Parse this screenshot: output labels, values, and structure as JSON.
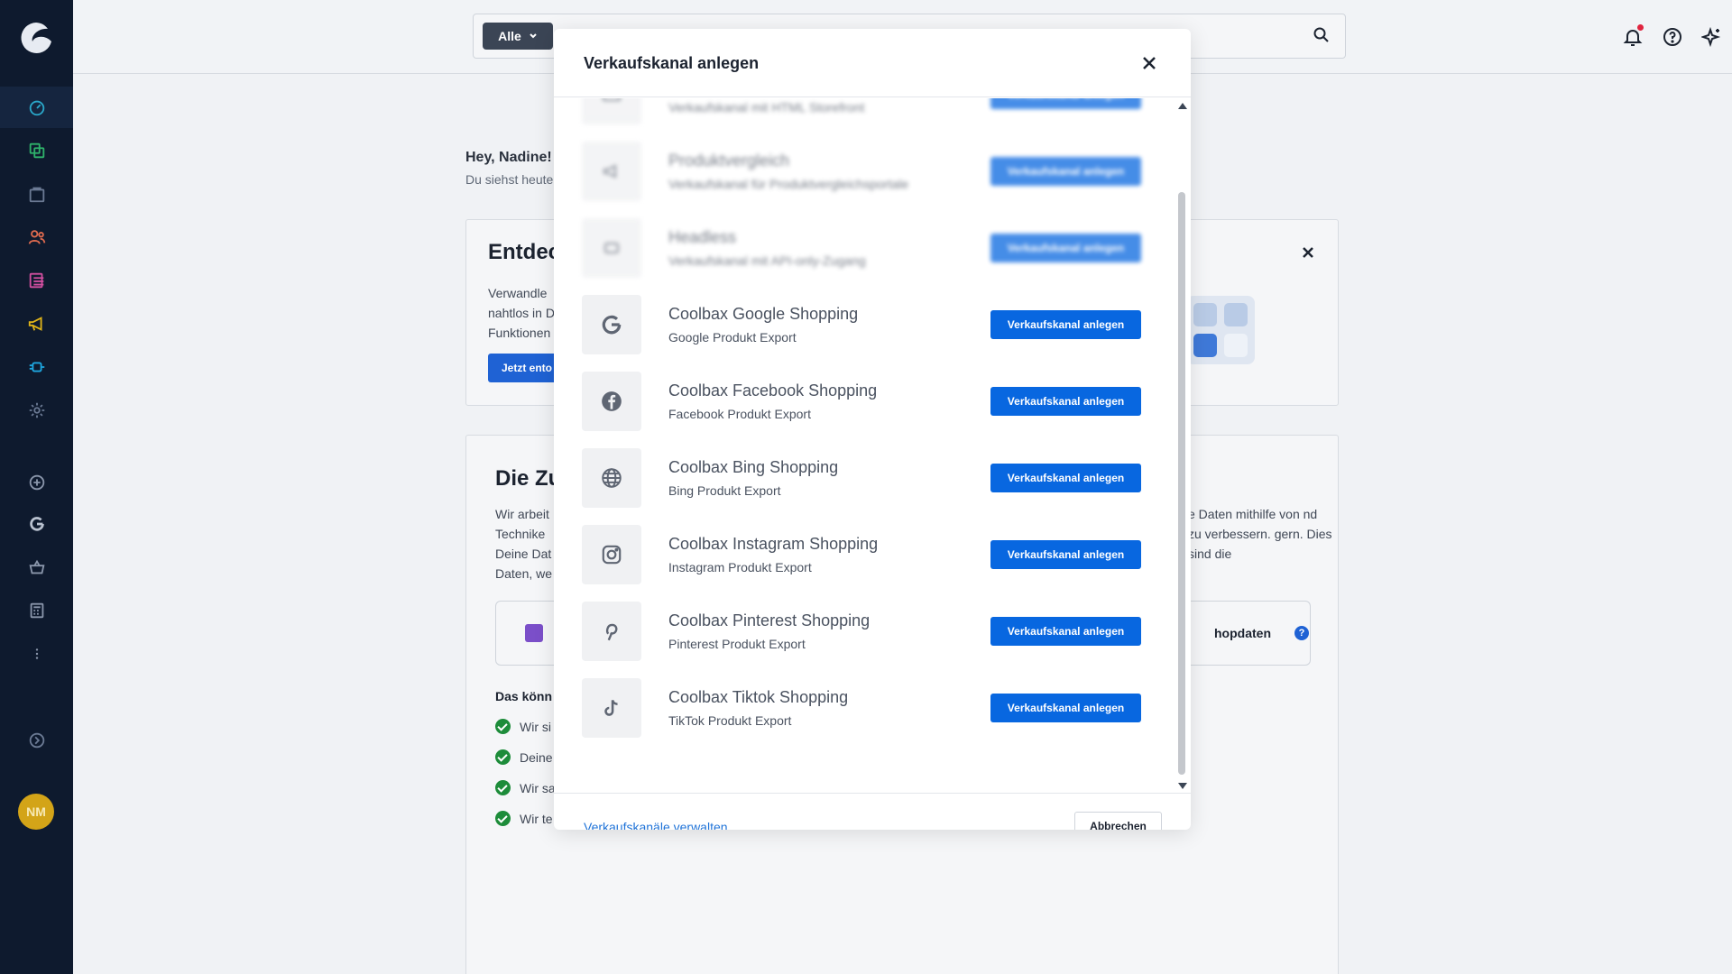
{
  "topbar": {
    "search_scope": "Alle"
  },
  "avatar": {
    "initials": "NM"
  },
  "dashboard": {
    "greeting": "Hey, Nadine!",
    "greeting_sub": "Du siehst heute",
    "card1": {
      "title": "Entdec",
      "text": "Verwandle nahtlos in D Funktionen",
      "button": "Jetzt ento"
    },
    "card2": {
      "title": "Die Zu",
      "text_left": "Wir arbeit Technike Deine Dat Daten, we",
      "text_right": "e Daten mithilfe von nd zu verbessern. gern. Dies sind die",
      "box_label": "hopdaten",
      "help": "?",
      "sub_heading": "Das könn",
      "checks": [
        "Wir si",
        "Deine",
        "Wir sa",
        "Wir te"
      ]
    }
  },
  "modal": {
    "title": "Verkaufskanal anlegen",
    "channels": [
      {
        "name": "",
        "desc": "Verkaufskanal mit HTML Storefront",
        "button": "Verkaufskanal anlegen",
        "icon": "storefront-icon",
        "blurred": true
      },
      {
        "name": "Produktvergleich",
        "desc": "Verkaufskanal für Produktvergleichsportale",
        "button": "Verkaufskanal anlegen",
        "icon": "megaphone-icon",
        "blurred": true
      },
      {
        "name": "Headless",
        "desc": "Verkaufskanal mit API-only-Zugang",
        "button": "Verkaufskanal anlegen",
        "icon": "plugin-icon",
        "blurred": true
      },
      {
        "name": "Coolbax Google Shopping",
        "desc": "Google Produkt Export",
        "button": "Verkaufskanal anlegen",
        "icon": "google-icon",
        "blurred": false
      },
      {
        "name": "Coolbax Facebook Shopping",
        "desc": "Facebook Produkt Export",
        "button": "Verkaufskanal anlegen",
        "icon": "facebook-icon",
        "blurred": false
      },
      {
        "name": "Coolbax Bing Shopping",
        "desc": "Bing Produkt Export",
        "button": "Verkaufskanal anlegen",
        "icon": "globe-icon",
        "blurred": false
      },
      {
        "name": "Coolbax Instagram Shopping",
        "desc": "Instagram Produkt Export",
        "button": "Verkaufskanal anlegen",
        "icon": "instagram-icon",
        "blurred": false
      },
      {
        "name": "Coolbax Pinterest Shopping",
        "desc": "Pinterest Produkt Export",
        "button": "Verkaufskanal anlegen",
        "icon": "pinterest-icon",
        "blurred": false
      },
      {
        "name": "Coolbax Tiktok Shopping",
        "desc": "TikTok Produkt Export",
        "button": "Verkaufskanal anlegen",
        "icon": "tiktok-icon",
        "blurred": false
      }
    ],
    "footer": {
      "manage_link": "Verkaufskanäle verwalten",
      "cancel": "Abbrechen"
    }
  },
  "colors": {
    "sidebar_bg": "#0e1a2e",
    "primary_button": "#0867e0",
    "link": "#1f73d8",
    "avatar_bg": "#d3a418"
  }
}
